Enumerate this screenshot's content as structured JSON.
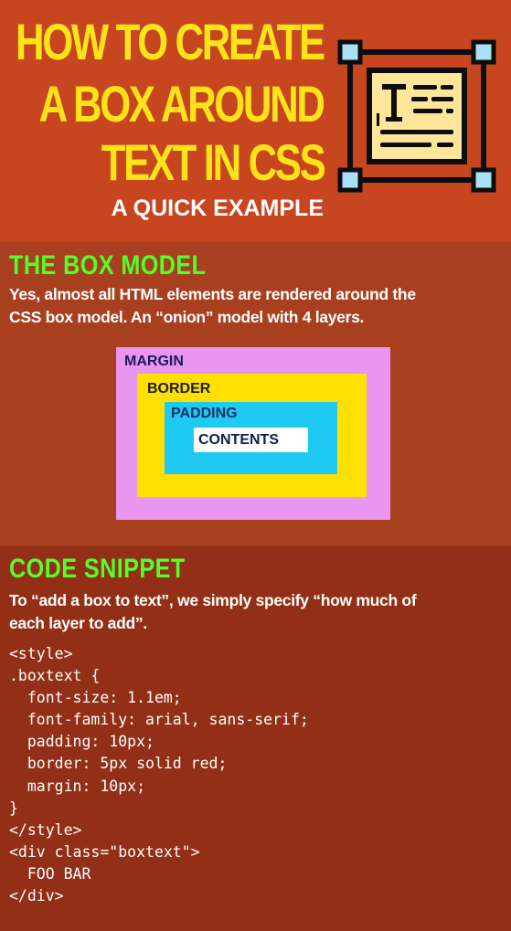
{
  "header": {
    "title_lines": [
      "HOW TO CREATE",
      "A BOX AROUND",
      "TEXT IN CSS"
    ],
    "subtitle": "A QUICK EXAMPLE",
    "icon": "text-document-selection-icon",
    "colors": {
      "background": "#c7461f",
      "title": "#ffe31a",
      "subtitle": "#ffffff"
    }
  },
  "box_model": {
    "heading": "THE BOX MODEL",
    "text_lines": [
      "Yes, almost all HTML elements are rendered around the",
      "CSS box model. An “onion” model with 4 layers."
    ],
    "layers": {
      "margin": {
        "label": "MARGIN",
        "color": "#ea95ef"
      },
      "border": {
        "label": "BORDER",
        "color": "#ffe000"
      },
      "padding": {
        "label": "PADDING",
        "color": "#1ec9f2"
      },
      "contents": {
        "label": "CONTENTS",
        "color": "#ffffff"
      }
    },
    "colors": {
      "background": "#a8401f",
      "heading": "#52ff2a"
    }
  },
  "code_snippet": {
    "heading": "CODE SNIPPET",
    "text_lines": [
      "To “add a box to text”, we simply specify “how much of",
      "each layer to add”."
    ],
    "code_lines": [
      "<style>",
      ".boxtext {",
      "  font-size: 1.1em;",
      "  font-family: arial, sans-serif;",
      "  padding: 10px;",
      "  border: 5px solid red;",
      "  margin: 10px;",
      "}",
      "</style>",
      "<div class=\"boxtext\">",
      "  FOO BAR",
      "</div>"
    ],
    "colors": {
      "background": "#922f16"
    }
  }
}
